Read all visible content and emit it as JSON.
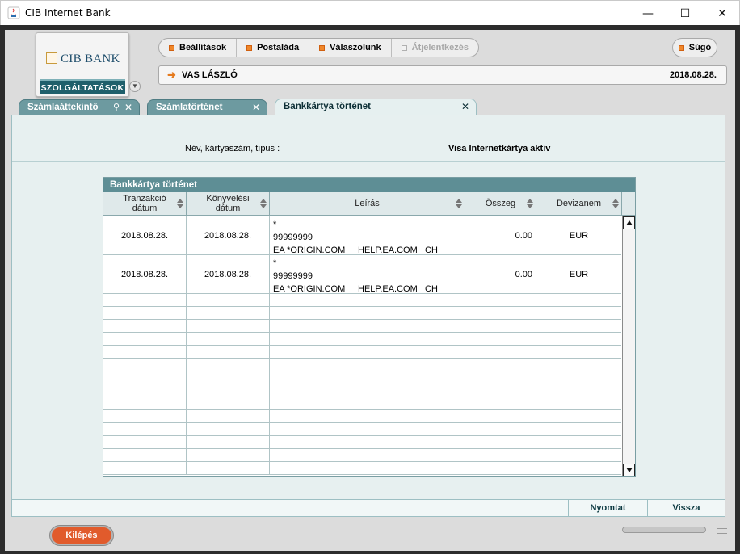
{
  "window": {
    "title": "CIB Internet Bank",
    "controls": [
      "—",
      "☐",
      "✕"
    ]
  },
  "logo": {
    "brand": "CIB BANK",
    "service_label": "SZOLGÁLTATÁSOK"
  },
  "topmenu": {
    "items": [
      {
        "label": "Beállítások",
        "enabled": true
      },
      {
        "label": "Postaláda",
        "enabled": true
      },
      {
        "label": "Válaszolunk",
        "enabled": true
      },
      {
        "label": "Átjelentkezés",
        "enabled": false
      }
    ],
    "help_label": "Súgó"
  },
  "userbar": {
    "arrow": "➜",
    "user": "VAS LÁSZLÓ",
    "date": "2018.08.28."
  },
  "tabs": [
    {
      "label": "Számlaáttekintő",
      "pin": "⚲",
      "close": "✕"
    },
    {
      "label": "Számlatörténet",
      "close": "✕"
    },
    {
      "label": "Bankkártya történet",
      "close": "✕"
    }
  ],
  "card_info": {
    "label": "Név, kártyaszám, típus :",
    "value": "Visa Internetkártya aktív"
  },
  "grid": {
    "title": "Bankkártya történet",
    "columns": [
      "Tranzakció\ndátum",
      "Könyvelési\ndátum",
      "Leírás",
      "Összeg",
      "Devizanem"
    ],
    "rows": [
      {
        "tx_date": "2018.08.28.",
        "book_date": "2018.08.28.",
        "desc_line1": "*",
        "desc_line2": "99999999",
        "desc_parts": [
          "EA *ORIGIN.COM",
          "HELP.EA.COM",
          "CH"
        ],
        "amount": "0.00",
        "currency": "EUR"
      },
      {
        "tx_date": "2018.08.28.",
        "book_date": "2018.08.28.",
        "desc_line1": "*",
        "desc_line2": "99999999",
        "desc_parts": [
          "EA *ORIGIN.COM",
          "HELP.EA.COM",
          "CH"
        ],
        "amount": "0.00",
        "currency": "EUR"
      }
    ]
  },
  "footer": {
    "print_label": "Nyomtat",
    "back_label": "Vissza",
    "exit_label": "Kilépés"
  }
}
